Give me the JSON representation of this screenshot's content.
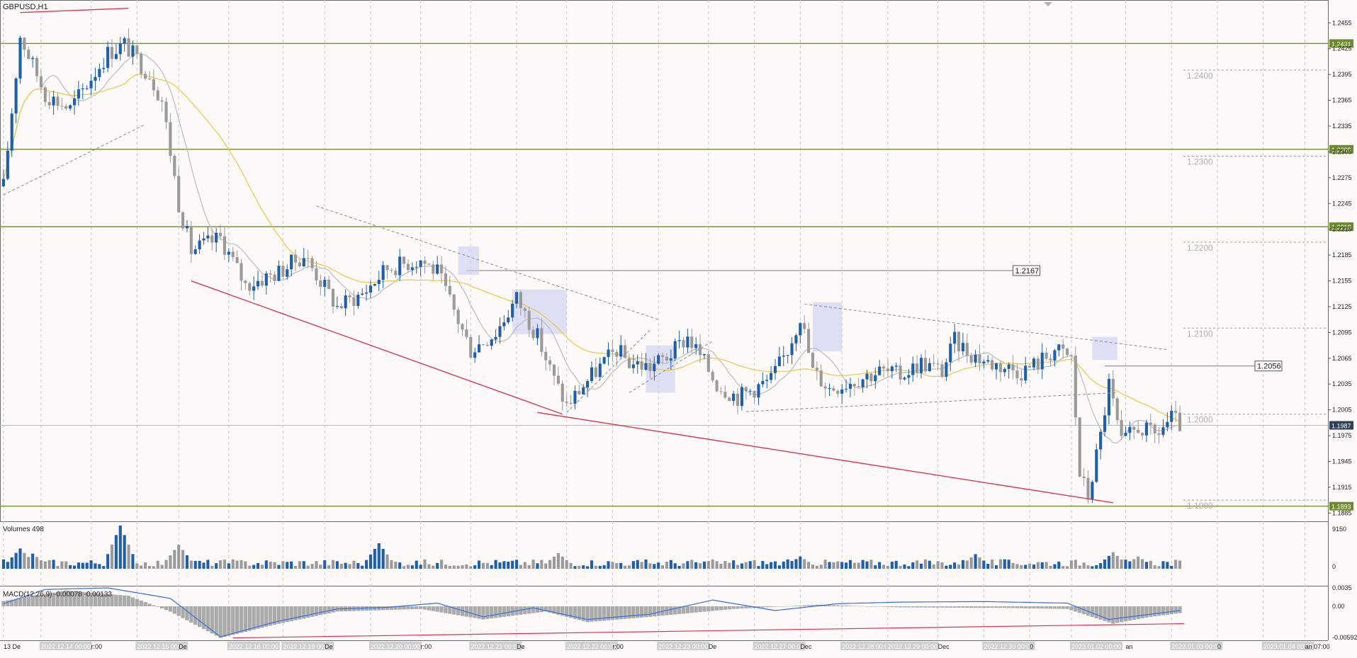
{
  "window": {
    "title": "GBPUSD,H1"
  },
  "colors": {
    "background": "#fcf9f8",
    "grid": "#c8c8c8",
    "bull_candle": "#1f5fa8",
    "bear_candle": "#9a9a9a",
    "ma_slow": "#e8c84a",
    "ma_fast": "#b8bcc0",
    "level_line": "#7a9a3a",
    "level_label_bg": "#6d8a2c",
    "trend_red": "#d23a5a",
    "dashed": "#8a8a8a",
    "zone": "#c9cdf2",
    "current_price_bg": "#2f3f57",
    "macd_signal": "#3a6fd8",
    "macd_hist": "#aaaaaa",
    "volume_up": "#1f5fa8",
    "volume_down": "#9a9a9a"
  },
  "chart_data": [
    {
      "type": "candlestick",
      "title": "GBPUSD,H1",
      "symbol": "GBPUSD",
      "timeframe": "H1",
      "ylim": [
        1.1882,
        1.2475
      ],
      "y_ticks": [
        "1.2455",
        "1.2425",
        "1.2395",
        "1.2365",
        "1.2335",
        "1.2305",
        "1.2275",
        "1.2245",
        "1.2215",
        "1.2185",
        "1.2155",
        "1.2125",
        "1.2095",
        "1.2065",
        "1.2035",
        "1.2005",
        "1.1975",
        "1.1945",
        "1.1915",
        "1.1885"
      ],
      "y_tick_values": [
        1.2455,
        1.2425,
        1.2395,
        1.2365,
        1.2335,
        1.2305,
        1.2275,
        1.2245,
        1.2215,
        1.2185,
        1.2155,
        1.2125,
        1.2095,
        1.2065,
        1.2035,
        1.2005,
        1.1975,
        1.1945,
        1.1915,
        1.1885
      ],
      "levels": [
        {
          "label": "1.2431",
          "value": 1.2431
        },
        {
          "label": "1.2308",
          "value": 1.2308
        },
        {
          "label": "1.2218",
          "value": 1.2218
        },
        {
          "label": "1.1893",
          "value": 1.1893
        }
      ],
      "current_price": {
        "label": "1.1987",
        "value": 1.1987
      },
      "round_levels": [
        {
          "label": "1.2400",
          "value": 1.24
        },
        {
          "label": "1.2300",
          "value": 1.23
        },
        {
          "label": "1.2200",
          "value": 1.22
        },
        {
          "label": "1.2100",
          "value": 1.21
        },
        {
          "label": "1.2000",
          "value": 1.2
        },
        {
          "label": "1.1900",
          "value": 1.19
        }
      ],
      "price_callouts": [
        {
          "label": "1.2167",
          "value": 1.2167
        },
        {
          "label": "1.2056",
          "value": 1.2056
        }
      ],
      "path_anchors": [
        {
          "bar": 0,
          "price": 1.2265
        },
        {
          "bar": 4,
          "price": 1.244
        },
        {
          "bar": 10,
          "price": 1.2372
        },
        {
          "bar": 16,
          "price": 1.2355
        },
        {
          "bar": 25,
          "price": 1.242
        },
        {
          "bar": 29,
          "price": 1.243
        },
        {
          "bar": 35,
          "price": 1.2395
        },
        {
          "bar": 38,
          "price": 1.2365
        },
        {
          "bar": 42,
          "price": 1.2245
        },
        {
          "bar": 45,
          "price": 1.219
        },
        {
          "bar": 52,
          "price": 1.2205
        },
        {
          "bar": 58,
          "price": 1.215
        },
        {
          "bar": 66,
          "price": 1.2165
        },
        {
          "bar": 72,
          "price": 1.2185
        },
        {
          "bar": 80,
          "price": 1.2125
        },
        {
          "bar": 86,
          "price": 1.214
        },
        {
          "bar": 92,
          "price": 1.217
        },
        {
          "bar": 100,
          "price": 1.218
        },
        {
          "bar": 104,
          "price": 1.2165
        },
        {
          "bar": 112,
          "price": 1.2075
        },
        {
          "bar": 118,
          "price": 1.2095
        },
        {
          "bar": 123,
          "price": 1.2135
        },
        {
          "bar": 128,
          "price": 1.209
        },
        {
          "bar": 132,
          "price": 1.204
        },
        {
          "bar": 135,
          "price": 1.201
        },
        {
          "bar": 141,
          "price": 1.2045
        },
        {
          "bar": 147,
          "price": 1.2075
        },
        {
          "bar": 150,
          "price": 1.206
        },
        {
          "bar": 155,
          "price": 1.2055
        },
        {
          "bar": 160,
          "price": 1.207
        },
        {
          "bar": 164,
          "price": 1.209
        },
        {
          "bar": 168,
          "price": 1.206
        },
        {
          "bar": 171,
          "price": 1.2035
        },
        {
          "bar": 176,
          "price": 1.202
        },
        {
          "bar": 180,
          "price": 1.203
        },
        {
          "bar": 184,
          "price": 1.204
        },
        {
          "bar": 188,
          "price": 1.2075
        },
        {
          "bar": 191,
          "price": 1.2115
        },
        {
          "bar": 194,
          "price": 1.205
        },
        {
          "bar": 198,
          "price": 1.203
        },
        {
          "bar": 204,
          "price": 1.204
        },
        {
          "bar": 210,
          "price": 1.205
        },
        {
          "bar": 215,
          "price": 1.2045
        },
        {
          "bar": 220,
          "price": 1.206
        },
        {
          "bar": 225,
          "price": 1.205
        },
        {
          "bar": 228,
          "price": 1.2085
        },
        {
          "bar": 232,
          "price": 1.207
        },
        {
          "bar": 236,
          "price": 1.206
        },
        {
          "bar": 240,
          "price": 1.2055
        },
        {
          "bar": 244,
          "price": 1.205
        },
        {
          "bar": 248,
          "price": 1.206
        },
        {
          "bar": 252,
          "price": 1.2075
        },
        {
          "bar": 256,
          "price": 1.2065
        },
        {
          "bar": 258,
          "price": 1.193
        },
        {
          "bar": 260,
          "price": 1.1905
        },
        {
          "bar": 263,
          "price": 1.1975
        },
        {
          "bar": 265,
          "price": 1.2035
        },
        {
          "bar": 268,
          "price": 1.1965
        },
        {
          "bar": 272,
          "price": 1.1985
        },
        {
          "bar": 276,
          "price": 1.1975
        },
        {
          "bar": 280,
          "price": 1.1995
        },
        {
          "bar": 282,
          "price": 1.1987
        }
      ],
      "trend_lines_red": [
        {
          "from": {
            "bar": 4,
            "price": 1.2467
          },
          "to": {
            "bar": 30,
            "price": 1.2472
          }
        },
        {
          "from": {
            "bar": 45,
            "price": 1.2155
          },
          "to": {
            "bar": 134,
            "price": 1.2
          }
        },
        {
          "from": {
            "bar": 128,
            "price": 1.2002
          },
          "to": {
            "bar": 266,
            "price": 1.1897
          }
        }
      ],
      "trend_lines_dashed": [
        {
          "from": {
            "bar": 0,
            "price": 1.2255
          },
          "to": {
            "bar": 34,
            "price": 1.2337
          }
        },
        {
          "from": {
            "bar": 75,
            "price": 1.2242
          },
          "to": {
            "bar": 157,
            "price": 1.211
          }
        },
        {
          "from": {
            "bar": 135,
            "price": 1.2002
          },
          "to": {
            "bar": 155,
            "price": 1.2098
          }
        },
        {
          "from": {
            "bar": 150,
            "price": 1.2025
          },
          "to": {
            "bar": 170,
            "price": 1.2085
          }
        },
        {
          "from": {
            "bar": 178,
            "price": 1.2003
          },
          "to": {
            "bar": 267,
            "price": 1.2025
          }
        },
        {
          "from": {
            "bar": 192,
            "price": 1.2128
          },
          "to": {
            "bar": 279,
            "price": 1.2075
          }
        }
      ],
      "zones": [
        {
          "bar_from": 109,
          "bar_to": 114,
          "price_from": 1.2195,
          "price_to": 1.2162
        },
        {
          "bar_from": 122,
          "bar_to": 135,
          "price_from": 1.2145,
          "price_to": 1.2093
        },
        {
          "bar_from": 154,
          "bar_to": 161,
          "price_from": 1.208,
          "price_to": 1.2025
        },
        {
          "bar_from": 194,
          "bar_to": 201,
          "price_from": 1.213,
          "price_to": 1.2073
        },
        {
          "bar_from": 261,
          "bar_to": 267,
          "price_from": 1.209,
          "price_to": 1.2063
        }
      ],
      "horizontal_rays": [
        {
          "bar_from": 111,
          "bar_to": 242,
          "value": 1.2167,
          "label": "1.2167"
        },
        {
          "bar_from": 264,
          "bar_to": 300,
          "value": 1.2056,
          "label": "1.2056"
        }
      ]
    },
    {
      "type": "bar",
      "title": "Volumes 498",
      "ylim": [
        0,
        9150
      ],
      "y_ticks": [
        "9150",
        "0"
      ],
      "y_tick_values": [
        9150,
        0
      ],
      "peaks": [
        {
          "bar": 4,
          "value": 4300
        },
        {
          "bar": 7,
          "value": 3200
        },
        {
          "bar": 28,
          "value": 9150
        },
        {
          "bar": 42,
          "value": 5100
        },
        {
          "bar": 90,
          "value": 5400
        },
        {
          "bar": 133,
          "value": 3300
        },
        {
          "bar": 191,
          "value": 2600
        },
        {
          "bar": 233,
          "value": 3100
        },
        {
          "bar": 266,
          "value": 3500
        },
        {
          "bar": 272,
          "value": 2600
        }
      ],
      "avg_value": 1500
    },
    {
      "type": "macd",
      "title": "MACD(12,26,9) -0.00078 -0.00133",
      "ylim": [
        -0.00592,
        0.0035
      ],
      "y_ticks": [
        "0.0035",
        "0.00",
        "-0.00592"
      ],
      "y_tick_values": [
        0.0035,
        0.0,
        -0.00592
      ],
      "signal_anchors": [
        {
          "bar": 0,
          "value": 0.0005
        },
        {
          "bar": 10,
          "value": 0.0032
        },
        {
          "bar": 25,
          "value": 0.0035
        },
        {
          "bar": 40,
          "value": 0.0015
        },
        {
          "bar": 52,
          "value": -0.0058
        },
        {
          "bar": 65,
          "value": -0.003
        },
        {
          "bar": 80,
          "value": -0.0005
        },
        {
          "bar": 92,
          "value": -0.0002
        },
        {
          "bar": 104,
          "value": 0.0006
        },
        {
          "bar": 115,
          "value": -0.002
        },
        {
          "bar": 127,
          "value": -0.0003
        },
        {
          "bar": 140,
          "value": -0.0025
        },
        {
          "bar": 155,
          "value": -0.0015
        },
        {
          "bar": 170,
          "value": 0.0012
        },
        {
          "bar": 185,
          "value": -0.0008
        },
        {
          "bar": 200,
          "value": 0.0005
        },
        {
          "bar": 215,
          "value": 0.0008
        },
        {
          "bar": 235,
          "value": 0.0009
        },
        {
          "bar": 255,
          "value": 0.0006
        },
        {
          "bar": 265,
          "value": -0.0025
        },
        {
          "bar": 275,
          "value": -0.0015
        },
        {
          "bar": 282,
          "value": -0.0008
        }
      ],
      "hist_anchors": [
        {
          "bar": 0,
          "value": 0.001
        },
        {
          "bar": 15,
          "value": 0.003
        },
        {
          "bar": 30,
          "value": 0.002
        },
        {
          "bar": 40,
          "value": -0.001
        },
        {
          "bar": 52,
          "value": -0.006
        },
        {
          "bar": 65,
          "value": -0.0035
        },
        {
          "bar": 80,
          "value": -0.001
        },
        {
          "bar": 100,
          "value": -0.0005
        },
        {
          "bar": 115,
          "value": -0.0025
        },
        {
          "bar": 130,
          "value": -0.001
        },
        {
          "bar": 140,
          "value": -0.003
        },
        {
          "bar": 155,
          "value": -0.002
        },
        {
          "bar": 175,
          "value": -0.0005
        },
        {
          "bar": 195,
          "value": 0.0003
        },
        {
          "bar": 215,
          "value": -0.0002
        },
        {
          "bar": 240,
          "value": -0.0003
        },
        {
          "bar": 255,
          "value": -0.0005
        },
        {
          "bar": 266,
          "value": -0.0033
        },
        {
          "bar": 275,
          "value": -0.002
        },
        {
          "bar": 282,
          "value": -0.0013
        }
      ],
      "red_line": {
        "from": {
          "bar": 55,
          "value": -0.006
        },
        "to": {
          "bar": 283,
          "value": -0.0033
        }
      }
    }
  ],
  "time_axis": {
    "labels": [
      "13 De",
      "2022.12.14 00:00",
      "r:00",
      "2022.12.15 00:00",
      "De",
      "2022.12.16 00:00",
      "2022.12.19 00:00",
      "De",
      "2022.12.20 00:00",
      "r:00",
      "2022.12.21 00:00",
      "De",
      "2022.12.22 00:00",
      "r:00",
      "2022.12.23 00:00",
      "De",
      "2022.12.27 00:00",
      "Dec",
      "2022.12.28 00:00",
      "2022.12.29 00:00",
      "Dec",
      "2022.12.30 00:00",
      "0",
      "2023.01.02 00:00",
      "an",
      "2023.01.03 00:00",
      "0",
      "2023.01.04 00:00",
      "an 07:00"
    ],
    "label_bars": [
      0,
      9,
      21,
      32,
      42,
      54,
      67,
      77,
      88,
      100,
      112,
      123,
      135,
      146,
      157,
      169,
      180,
      191,
      201,
      212,
      224,
      235,
      246,
      256,
      269,
      280,
      291,
      302,
      312
    ]
  }
}
